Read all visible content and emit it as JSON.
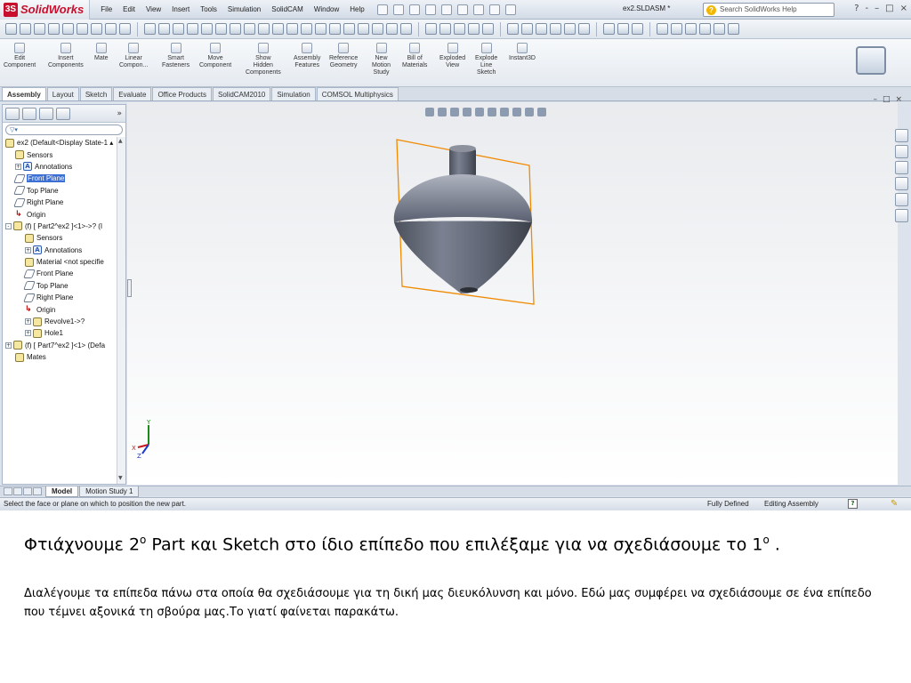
{
  "app": {
    "logo_text": "SolidWorks",
    "menu": [
      "File",
      "Edit",
      "View",
      "Insert",
      "Tools",
      "Simulation",
      "SolidCAM",
      "Window",
      "Help"
    ],
    "document_title": "ex2.SLDASM *",
    "search_placeholder": "Search SolidWorks Help",
    "window_controls": [
      "?",
      "-",
      "–",
      "□",
      "×"
    ]
  },
  "command_manager": {
    "commands": [
      {
        "label": "Edit\nComponent"
      },
      {
        "label": "Insert\nComponents"
      },
      {
        "label": "Mate"
      },
      {
        "label": "Linear\nCompon..."
      },
      {
        "label": "Smart\nFasteners"
      },
      {
        "label": "Move\nComponent"
      },
      {
        "label": "Show\nHidden\nComponents"
      },
      {
        "label": "Assembly\nFeatures"
      },
      {
        "label": "Reference\nGeometry"
      },
      {
        "label": "New\nMotion\nStudy"
      },
      {
        "label": "Bill of\nMaterials"
      },
      {
        "label": "Exploded\nView"
      },
      {
        "label": "Explode\nLine\nSketch"
      },
      {
        "label": "Instant3D"
      }
    ],
    "tabs": [
      "Assembly",
      "Layout",
      "Sketch",
      "Evaluate",
      "Office Products",
      "SolidCAM2010",
      "Simulation",
      "COMSOL Multiphysics"
    ],
    "active_tab": "Assembly"
  },
  "feature_tree": {
    "more_glyph": "»",
    "filter_glyph": "▽▾",
    "items": [
      {
        "label": "ex2  (Default<Display State-1 ▴",
        "icon": "assembly",
        "indent": 0
      },
      {
        "label": "Sensors",
        "icon": "sensor",
        "indent": 1
      },
      {
        "label": "Annotations",
        "icon": "annotation",
        "indent": 1,
        "expander": "+"
      },
      {
        "label": "Front Plane",
        "icon": "plane",
        "indent": 1,
        "selected": true
      },
      {
        "label": "Top Plane",
        "icon": "plane",
        "indent": 1
      },
      {
        "label": "Right Plane",
        "icon": "plane",
        "indent": 1
      },
      {
        "label": "Origin",
        "icon": "origin",
        "indent": 1
      },
      {
        "label": "(f) [ Part2^ex2 ]<1>->? (I",
        "icon": "part",
        "indent": 0,
        "expander": "-"
      },
      {
        "label": "Sensors",
        "icon": "sensor",
        "indent": 2
      },
      {
        "label": "Annotations",
        "icon": "annotation",
        "indent": 2,
        "expander": "+"
      },
      {
        "label": "Material <not specifie",
        "icon": "material",
        "indent": 2
      },
      {
        "label": "Front Plane",
        "icon": "plane",
        "indent": 2
      },
      {
        "label": "Top Plane",
        "icon": "plane",
        "indent": 2
      },
      {
        "label": "Right Plane",
        "icon": "plane",
        "indent": 2
      },
      {
        "label": "Origin",
        "icon": "origin",
        "indent": 2
      },
      {
        "label": "Revolve1->?",
        "icon": "feature",
        "indent": 2,
        "expander": "+"
      },
      {
        "label": "Hole1",
        "icon": "feature",
        "indent": 2,
        "expander": "+"
      },
      {
        "label": "(f) [ Part7^ex2 ]<1> (Defa",
        "icon": "part",
        "indent": 0,
        "expander": "+"
      },
      {
        "label": "Mates",
        "icon": "mates",
        "indent": 1
      }
    ]
  },
  "viewport": {
    "triad_labels": {
      "x": "X",
      "y": "Y",
      "z": "Z"
    },
    "controls": [
      "–",
      "□",
      "×"
    ],
    "colors": {
      "part": "#5c6270",
      "bounding_box": "#f08a00"
    }
  },
  "bottom_tabs": [
    "Model",
    "Motion Study 1"
  ],
  "status": {
    "message": "Select the face or plane on which to position the new part.",
    "definition": "Fully Defined",
    "mode": "Editing Assembly",
    "help_glyph": "?"
  },
  "slide": {
    "caption_a": "Φτιάχνουμε 2",
    "caption_sup_a": "ο",
    "caption_b": " Part και Sketch στο ίδιο επίπεδο που επιλέξαμε για να σχεδιάσουμε το 1",
    "caption_sup_b": "ο",
    "caption_c": " .",
    "description": "Διαλέγουμε τα επίπεδα πάνω στα οποία θα σχεδιάσουμε για τη δική μας διευκόλυνση και μόνο. Εδώ μας συμφέρει να σχεδιάσουμε σε ένα επίπεδο που τέμνει αξονικά τη σβούρα μας.Το γιατί φαίνεται παρακάτω."
  }
}
